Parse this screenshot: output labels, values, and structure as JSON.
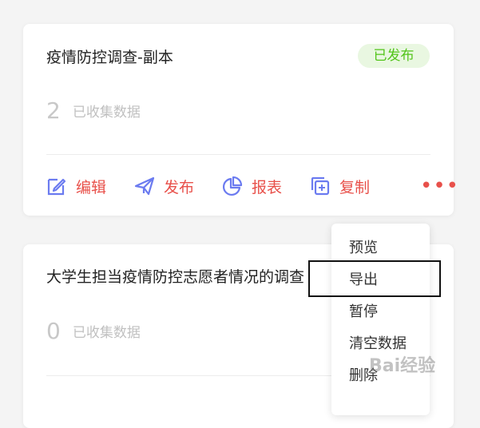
{
  "surveys": [
    {
      "title": "疫情防控调查-副本",
      "status": "已发布",
      "count": "2",
      "count_label": "已收集数据"
    },
    {
      "title": "大学生担当疫情防控志愿者情况的调查",
      "count": "0",
      "count_label": "已收集数据"
    }
  ],
  "actions": {
    "edit": "编辑",
    "publish": "发布",
    "report": "报表",
    "copy": "复制",
    "more": "•••"
  },
  "menu": {
    "items": [
      "预览",
      "导出",
      "暂停",
      "清空数据",
      "删除"
    ]
  },
  "watermark": "Bai经验",
  "colors": {
    "accent": "#e8504a",
    "icon": "#6b7bf0",
    "badge_bg": "#e9f7e1",
    "badge_text": "#52c41a"
  }
}
